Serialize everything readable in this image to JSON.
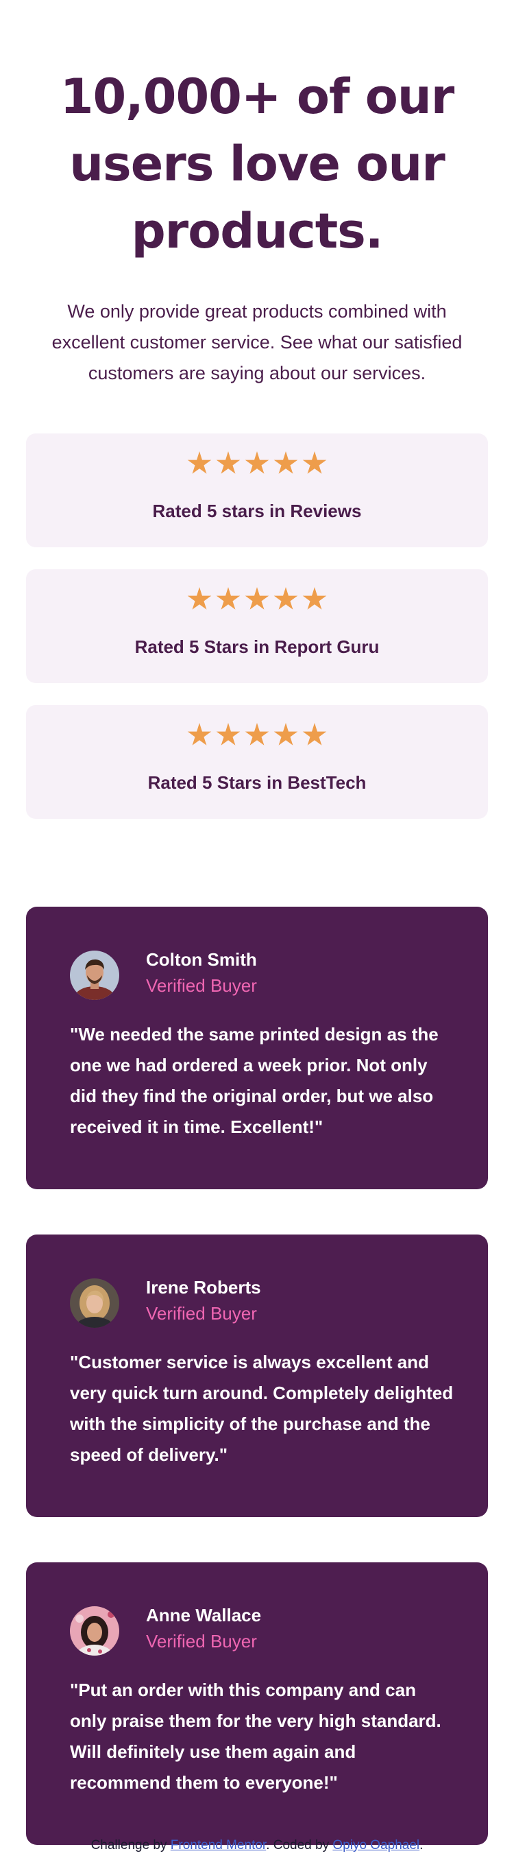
{
  "hero": {
    "title": "10,000+ of our users love our products.",
    "description": "We only provide great products combined with excellent customer service. See what our satisfied customers are saying about our services."
  },
  "ratings": [
    {
      "stars": 5,
      "label": "Rated 5 stars in Reviews"
    },
    {
      "stars": 5,
      "label": "Rated 5 Stars in Report Guru"
    },
    {
      "stars": 5,
      "label": "Rated 5 Stars in BestTech"
    }
  ],
  "testimonials": [
    {
      "name": "Colton Smith",
      "status": "Verified Buyer",
      "quote": "\"We needed the same printed design as the one we had ordered a week prior. Not only did they find the original order, but we also received it in time. Excellent!\""
    },
    {
      "name": "Irene Roberts",
      "status": "Verified Buyer",
      "quote": "\"Customer service is always excellent and very quick turn around. Completely delighted with the simplicity of the purchase and the speed of delivery.\""
    },
    {
      "name": "Anne Wallace",
      "status": "Verified Buyer",
      "quote": "\"Put an order with this company and can only praise them for the very high standard. Will definitely use them again and recommend them to everyone!\""
    }
  ],
  "footer": {
    "prefix": "Challenge by",
    "challenge_link": "Frontend Mentor",
    "middle": ". Coded by",
    "author_link": "Opiyo Oaphael",
    "suffix": "."
  },
  "colors": {
    "primary": "#4a1d4b",
    "card_bg": "#4e1e50",
    "rating_bg": "#f7f1f8",
    "star": "#ee9d4b",
    "verified": "#ef66b2"
  }
}
